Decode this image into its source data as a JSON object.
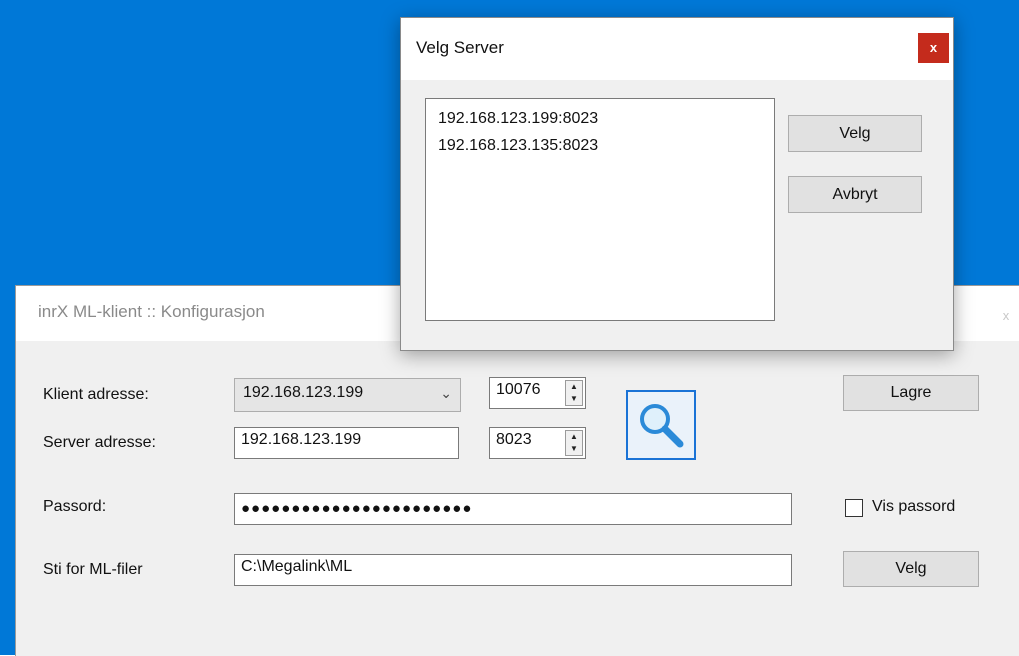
{
  "main_window": {
    "title": "inrX ML-klient :: Konfigurasjon",
    "close_glyph": "x",
    "client_address_label": "Klient adresse:",
    "client_address_value": "192.168.123.199",
    "client_port_value": "10076",
    "server_address_label": "Server adresse:",
    "server_address_value": "192.168.123.199",
    "server_port_value": "8023",
    "save_label": "Lagre",
    "password_label": "Passord:",
    "password_mask": "●●●●●●●●●●●●●●●●●●●●●●●",
    "show_password_label": "Vis passord",
    "show_password_checked": false,
    "path_label": "Sti for ML-filer",
    "path_value": "C:\\Megalink\\ML",
    "path_choose_label": "Velg",
    "search_icon": "magnifier-icon"
  },
  "dialog": {
    "title": "Velg Server",
    "close_glyph": "x",
    "servers": [
      "192.168.123.199:8023",
      "192.168.123.135:8023"
    ],
    "choose_label": "Velg",
    "cancel_label": "Avbryt"
  },
  "colors": {
    "desktop": "#0078d7",
    "close_red": "#c42b1c",
    "search_border": "#1a73d6"
  }
}
